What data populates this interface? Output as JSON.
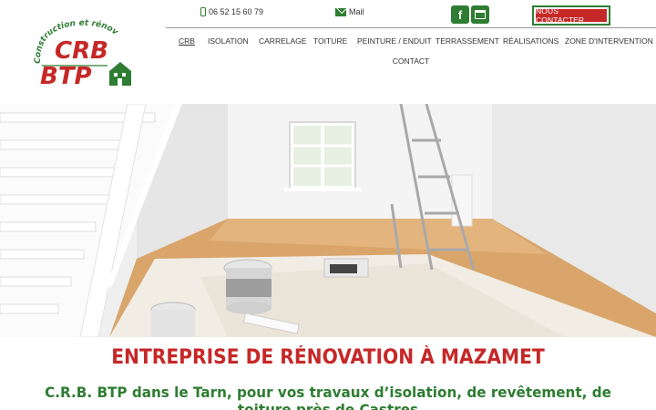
{
  "logo": {
    "arc_text": "Construction et rénovation",
    "line1": "CRB",
    "line2": "BTP"
  },
  "topbar": {
    "phone": "06 52 15 60 79",
    "mail": "Mail",
    "facebook_icon": "facebook-icon",
    "business_icon": "google-business-icon",
    "contact_button": "NOUS CONTACTER"
  },
  "nav": {
    "items": [
      {
        "label": "CRB"
      },
      {
        "label": "ISOLATION"
      },
      {
        "label": "CARRELAGE"
      },
      {
        "label": "TOITURE"
      },
      {
        "label": "PEINTURE / ENDUIT"
      },
      {
        "label": "TERRASSEMENT"
      },
      {
        "label": "RÉALISATIONS"
      },
      {
        "label": "ZONE D'INTERVENTION"
      },
      {
        "label": "CONTACT"
      }
    ]
  },
  "main": {
    "title": "ENTREPRISE DE RÉNOVATION À MAZAMET",
    "subtitle": "C.R.B. BTP dans le Tarn, pour vos travaux d’isolation, de revêtement, de toiture près de Castres"
  },
  "colors": {
    "brand_red": "#c62828",
    "brand_green": "#2e7d32"
  }
}
